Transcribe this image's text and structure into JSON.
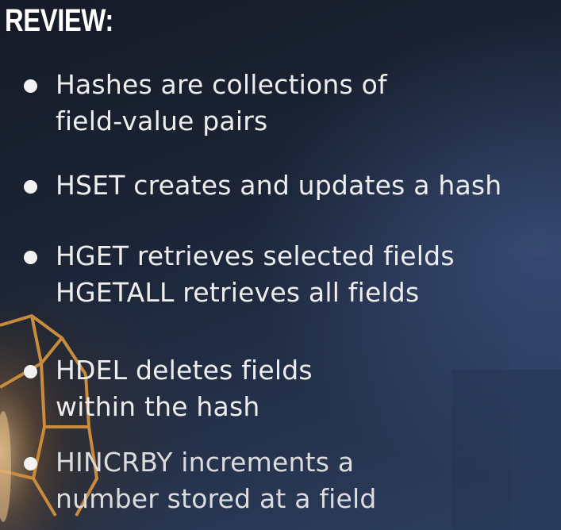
{
  "slide": {
    "title": "REVIEW:",
    "bullets": [
      {
        "line1": "Hashes are collections of",
        "line2": "field-value pairs"
      },
      {
        "line1": "HSET creates and updates a hash",
        "line2": ""
      },
      {
        "line1": "HGET retrieves selected fields",
        "line2": "HGETALL retrieves all fields"
      },
      {
        "line1": "HDEL deletes fields",
        "line2": "within the hash"
      },
      {
        "line1": "HINCRBY increments a",
        "line2": "number stored at a field"
      }
    ]
  },
  "colors": {
    "text": "#eeeeee",
    "title": "#ffffff",
    "background": "#1c2537",
    "accent_lamp": "#c8893a"
  }
}
